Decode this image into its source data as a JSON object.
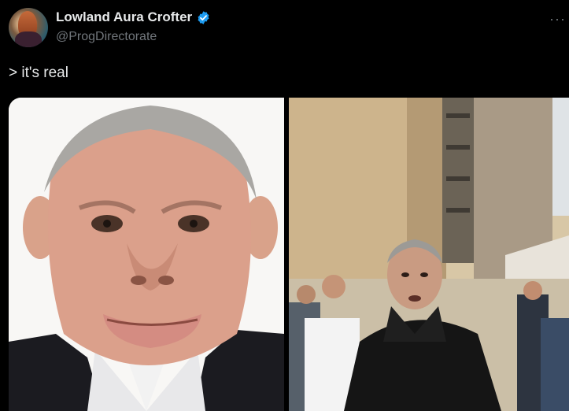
{
  "tweet": {
    "author_name": "Lowland Aura Crofter",
    "author_handle": "@ProgDirectorate",
    "text": "> it's real",
    "more_label": "···"
  },
  "icons": {
    "avatar": "avatar-image",
    "verified": "verified-badge-icon",
    "more": "more-options-icon"
  },
  "colors": {
    "background": "#000000",
    "text": "#e7e9ea",
    "secondary": "#71767b",
    "verified": "#1d9bf0"
  }
}
